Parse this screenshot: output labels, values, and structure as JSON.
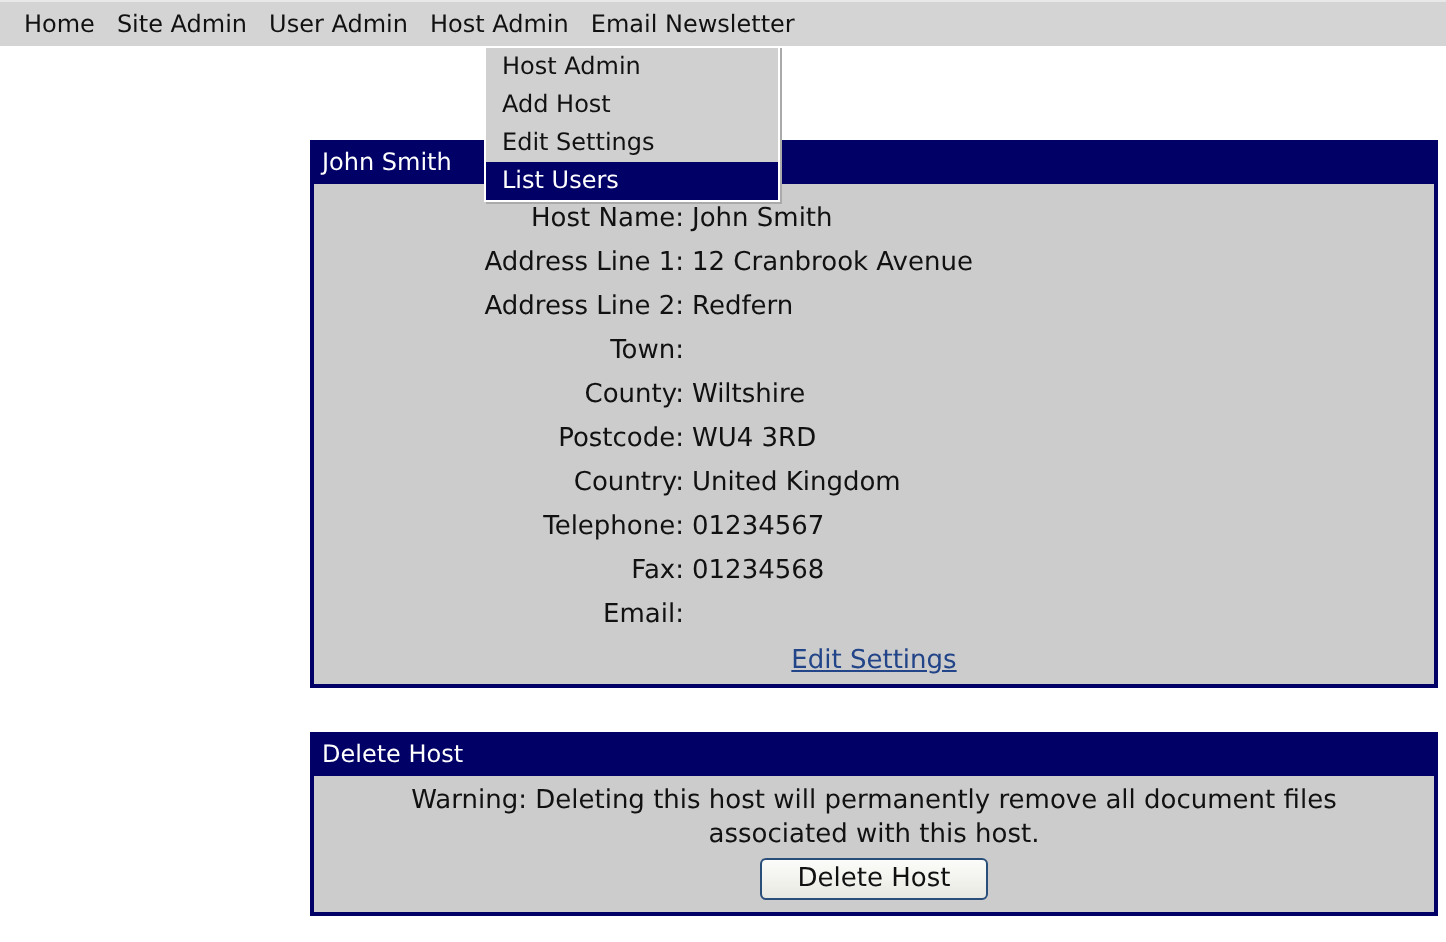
{
  "menu_bar": {
    "items": [
      {
        "label": "Home"
      },
      {
        "label": "Site Admin"
      },
      {
        "label": "User Admin"
      },
      {
        "label": "Host Admin"
      },
      {
        "label": "Email Newsletter"
      }
    ]
  },
  "dropdown": {
    "items": [
      {
        "label": "Host Admin",
        "selected": false
      },
      {
        "label": "Add Host",
        "selected": false
      },
      {
        "label": "Edit Settings",
        "selected": false
      },
      {
        "label": "List Users",
        "selected": true
      }
    ]
  },
  "host_panel": {
    "title": "John Smith",
    "fields": [
      {
        "label": "Host Name:",
        "value": "John Smith"
      },
      {
        "label": "Address Line 1:",
        "value": "12 Cranbrook Avenue"
      },
      {
        "label": "Address Line 2:",
        "value": "Redfern"
      },
      {
        "label": "Town:"
      },
      {
        "label": "County:",
        "value": "Wiltshire"
      },
      {
        "label": "Postcode:",
        "value": "WU4 3RD"
      },
      {
        "label": "Country:",
        "value": "United Kingdom"
      },
      {
        "label": "Telephone:",
        "value": "01234567"
      },
      {
        "label": "Fax:",
        "value": "01234568"
      },
      {
        "label": "Email:"
      }
    ],
    "link": "Edit Settings"
  },
  "delete_panel": {
    "title": "Delete Host",
    "warning": "Warning: Deleting this host will permanently remove all document files associated with this host.",
    "button": "Delete Host"
  }
}
